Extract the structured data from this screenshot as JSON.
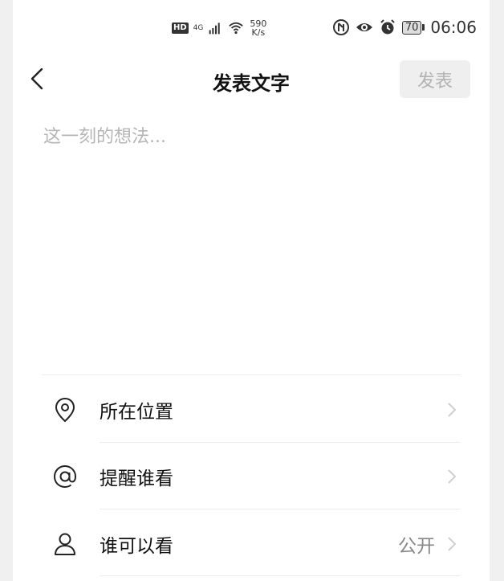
{
  "status_bar": {
    "hd": "HD",
    "network": "4G",
    "speed_value": "590",
    "speed_unit": "K/s",
    "battery": "70",
    "time": "06:06"
  },
  "nav": {
    "title": "发表文字",
    "publish_label": "发表"
  },
  "compose": {
    "placeholder": "这一刻的想法..."
  },
  "options": [
    {
      "label": "所在位置",
      "icon": "location-pin-icon",
      "value": ""
    },
    {
      "label": "提醒谁看",
      "icon": "at-sign-icon",
      "value": ""
    },
    {
      "label": "谁可以看",
      "icon": "person-icon",
      "value": "公开"
    }
  ]
}
